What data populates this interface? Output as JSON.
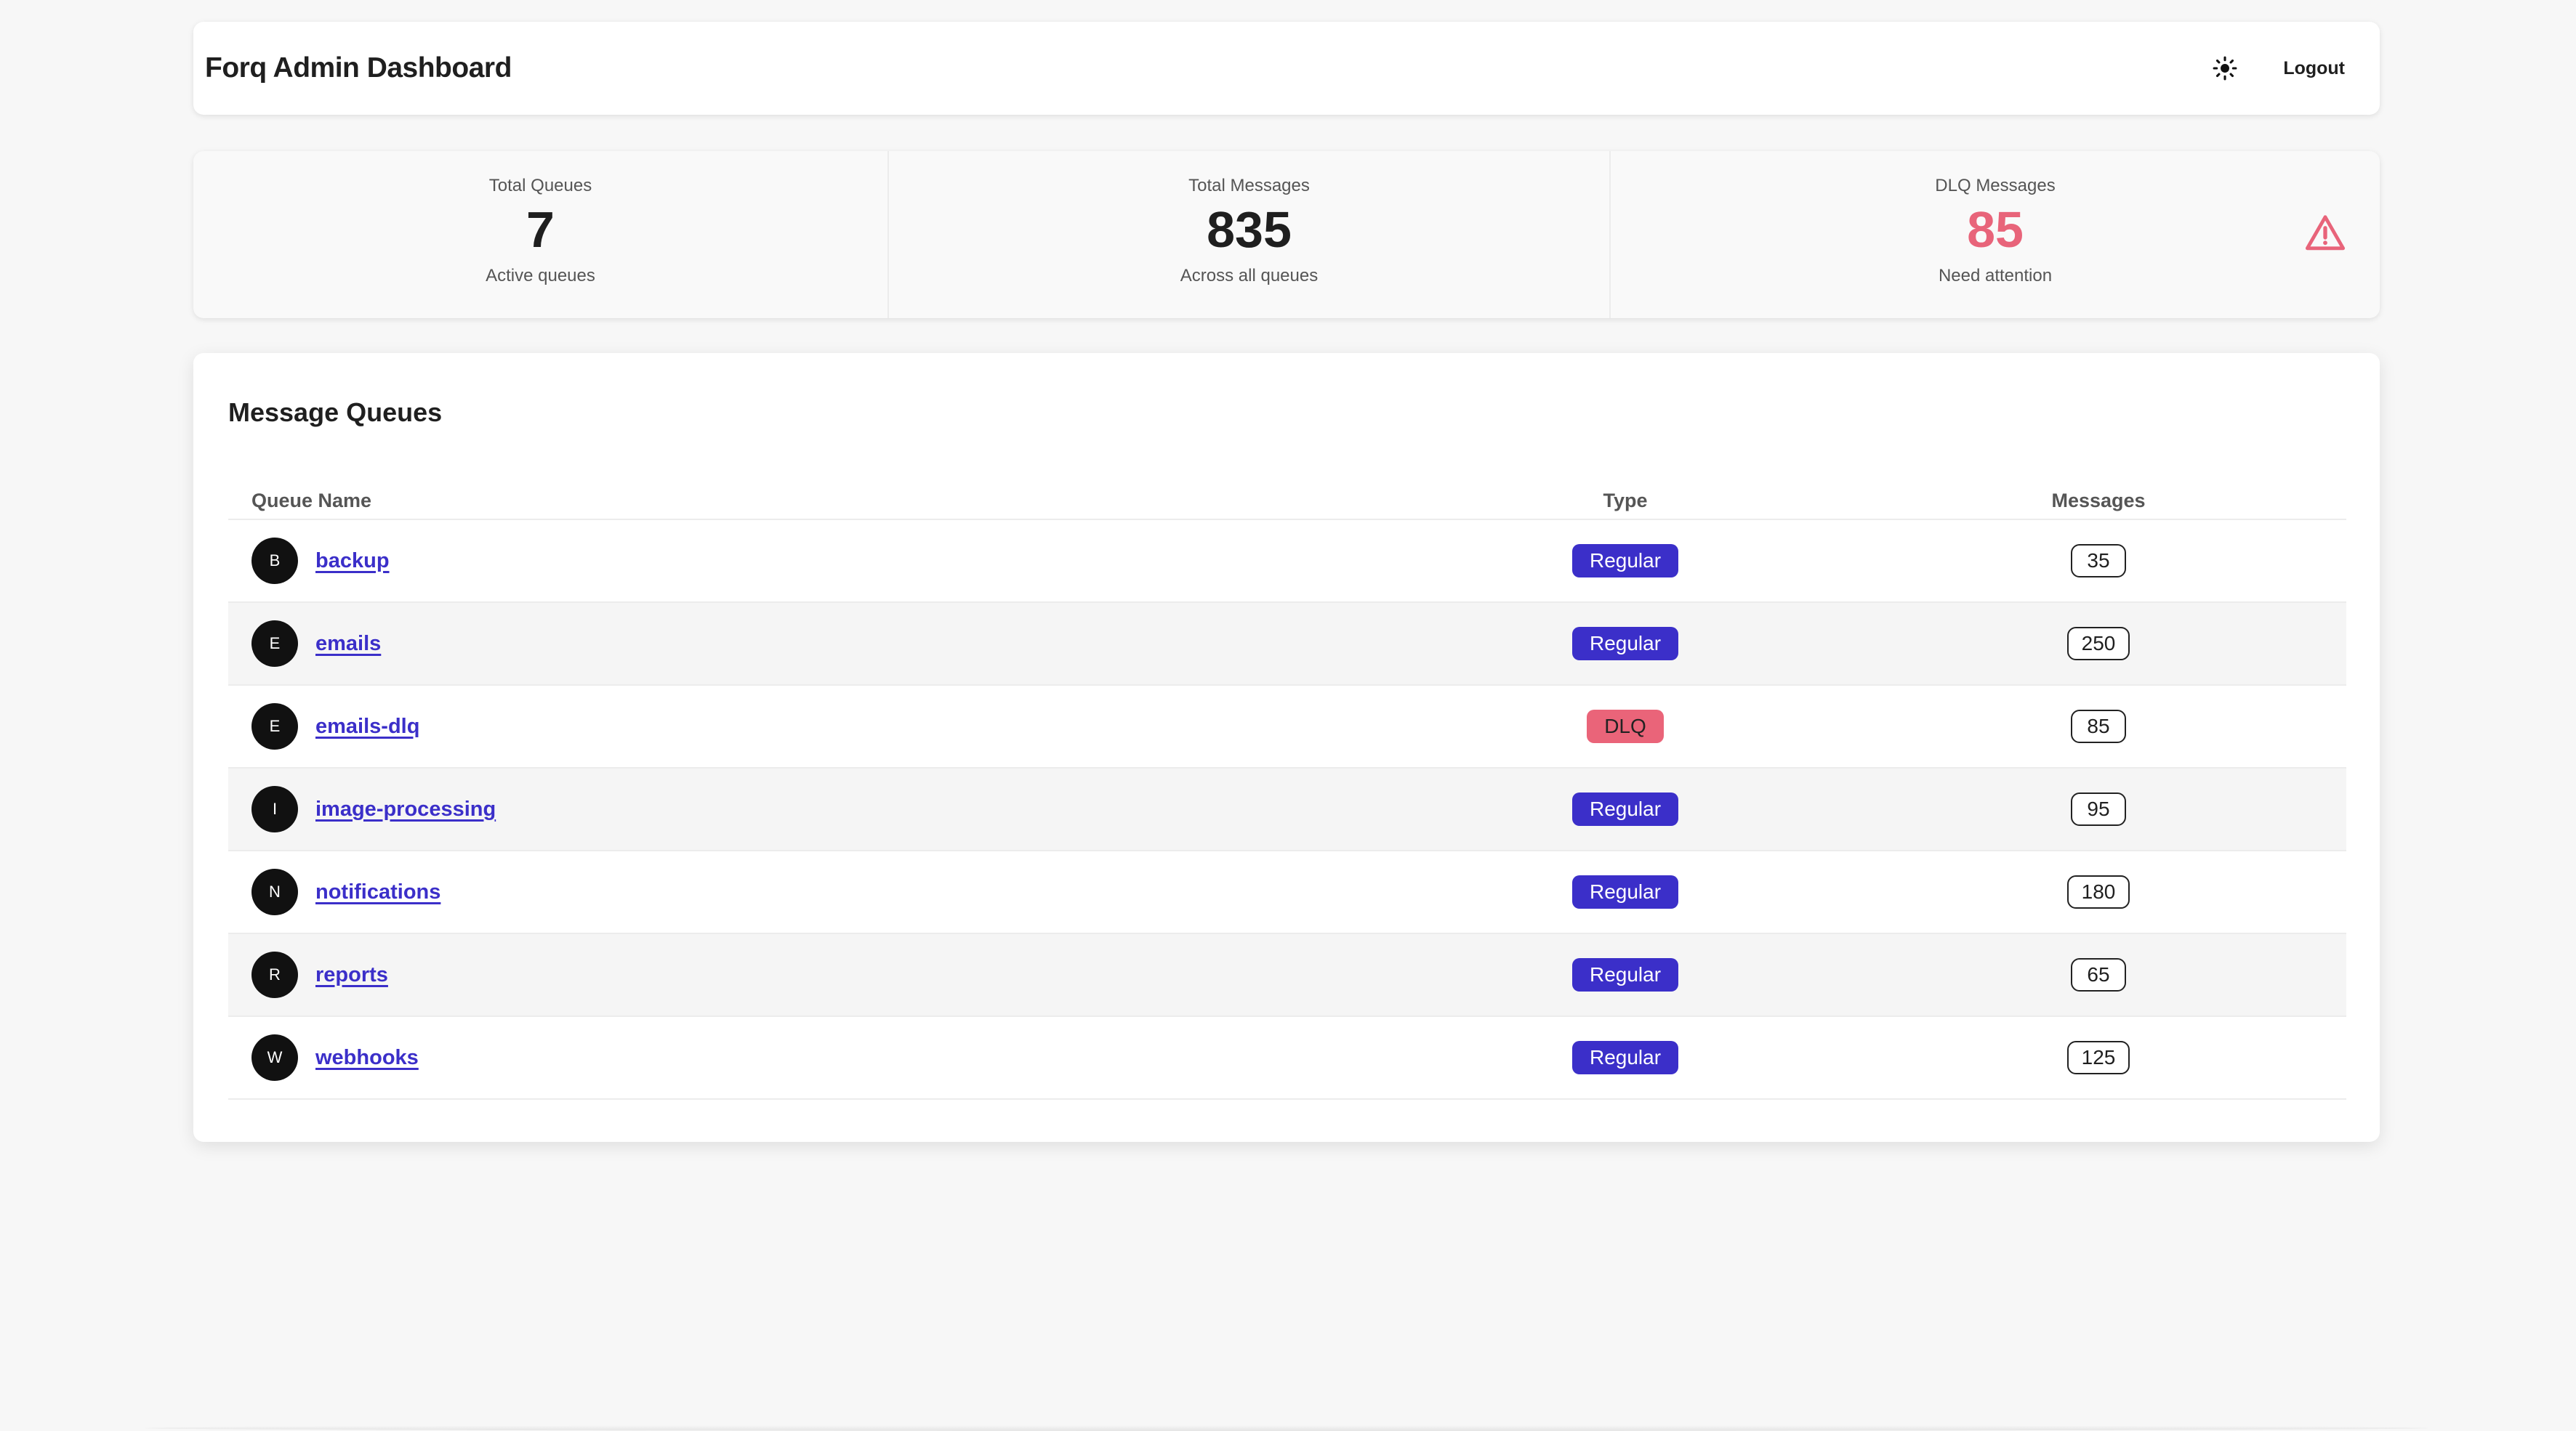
{
  "header": {
    "title": "Forq Admin Dashboard",
    "theme_icon": "sun-icon",
    "logout_label": "Logout"
  },
  "stats": [
    {
      "label": "Total Queues",
      "value": "7",
      "description": "Active queues"
    },
    {
      "label": "Total Messages",
      "value": "835",
      "description": "Across all queues"
    },
    {
      "label": "DLQ Messages",
      "value": "85",
      "description": "Need attention",
      "icon": "warning-triangle-icon",
      "accent": "#e8647a"
    }
  ],
  "queues": {
    "title": "Message Queues",
    "columns": [
      "Queue Name",
      "Type",
      "Messages"
    ],
    "rows": [
      {
        "initial": "B",
        "name": "backup",
        "type": "Regular",
        "messages": "35"
      },
      {
        "initial": "E",
        "name": "emails",
        "type": "Regular",
        "messages": "250"
      },
      {
        "initial": "E",
        "name": "emails-dlq",
        "type": "DLQ",
        "messages": "85"
      },
      {
        "initial": "I",
        "name": "image-processing",
        "type": "Regular",
        "messages": "95"
      },
      {
        "initial": "N",
        "name": "notifications",
        "type": "Regular",
        "messages": "180"
      },
      {
        "initial": "R",
        "name": "reports",
        "type": "Regular",
        "messages": "65"
      },
      {
        "initial": "W",
        "name": "webhooks",
        "type": "Regular",
        "messages": "125"
      }
    ]
  },
  "colors": {
    "background": "#f7f7f7",
    "regular_badge": "#3b2fc9",
    "dlq_badge": "#ea6479",
    "link": "#3b2fc9",
    "alert": "#e8647a"
  }
}
